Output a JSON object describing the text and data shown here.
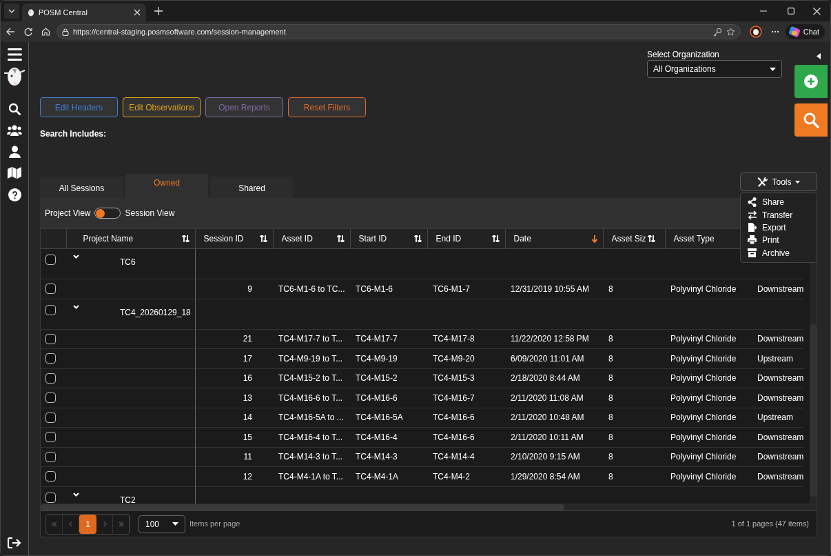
{
  "browser": {
    "tab_title": "POSM Central",
    "url": "https://central-staging.posmsoftware.com/session-management",
    "chat_label": "Chat"
  },
  "organization": {
    "label": "Select Organization",
    "value": "All Organizations"
  },
  "action_buttons": [
    {
      "label": "Edit Headers",
      "color": "#3f7dd6"
    },
    {
      "label": "Edit Observations",
      "color": "#e0a21a"
    },
    {
      "label": "Open Reports",
      "color": "#7d6aa8"
    },
    {
      "label": "Reset Filters",
      "color": "#e0692a"
    }
  ],
  "search_includes": "Search Includes:",
  "tabs": [
    {
      "label": "All Sessions",
      "selected": false
    },
    {
      "label": "Owned",
      "selected": true
    },
    {
      "label": "Shared",
      "selected": false
    }
  ],
  "view_toggle": {
    "left_label": "Project View",
    "right_label": "Session View",
    "on": false
  },
  "tools": {
    "label": "Tools",
    "expanded": true,
    "menu": [
      {
        "label": "Share"
      },
      {
        "label": "Transfer"
      },
      {
        "label": "Export"
      },
      {
        "label": "Print"
      },
      {
        "label": "Archive"
      }
    ]
  },
  "table": {
    "columns": [
      {
        "label": "Project Name",
        "sortable": true,
        "sorted_descending": false
      },
      {
        "label": "Session ID",
        "sortable": true,
        "sorted_descending": false
      },
      {
        "label": "Asset ID",
        "sortable": true,
        "sorted_descending": false
      },
      {
        "label": "Start ID",
        "sortable": true,
        "sorted_descending": false
      },
      {
        "label": "End ID",
        "sortable": true,
        "sorted_descending": false
      },
      {
        "label": "Date",
        "sortable": true,
        "sorted_descending": true
      },
      {
        "label": "Asset Siz",
        "sortable": true,
        "sorted_descending": false
      },
      {
        "label": "Asset Type",
        "sortable": false,
        "sorted_descending": false
      }
    ],
    "groups": [
      {
        "name": "TC6",
        "expanded": true,
        "checked": false,
        "rows": [
          {
            "checked": false,
            "session_id": "9",
            "asset_id": "TC6-M1-6 to TC...",
            "start_id": "TC6-M1-6",
            "end_id": "TC6-M1-7",
            "date": "12/31/2019 10:55 AM",
            "asset_size": "8",
            "asset_type": "Polyvinyl Chloride",
            "column_10": "Downstream"
          }
        ]
      },
      {
        "name": "TC4_20260129_18",
        "expanded": true,
        "checked": false,
        "rows": [
          {
            "checked": false,
            "session_id": "21",
            "asset_id": "TC4-M17-7 to T...",
            "start_id": "TC4-M17-7",
            "end_id": "TC4-M17-8",
            "date": "11/22/2020 12:58 PM",
            "asset_size": "8",
            "asset_type": "Polyvinyl Chloride",
            "column_10": "Downstream"
          },
          {
            "checked": false,
            "session_id": "17",
            "asset_id": "TC4-M9-19 to T...",
            "start_id": "TC4-M9-19",
            "end_id": "TC4-M9-20",
            "date": "6/09/2020 11:01 AM",
            "asset_size": "8",
            "asset_type": "Polyvinyl Chloride",
            "column_10": "Upstream"
          },
          {
            "checked": false,
            "session_id": "16",
            "asset_id": "TC4-M15-2 to T...",
            "start_id": "TC4-M15-2",
            "end_id": "TC4-M15-3",
            "date": "2/18/2020 8:44 AM",
            "asset_size": "8",
            "asset_type": "Polyvinyl Chloride",
            "column_10": "Downstream"
          },
          {
            "checked": false,
            "session_id": "13",
            "asset_id": "TC4-M16-6 to T...",
            "start_id": "TC4-M16-6",
            "end_id": "TC4-M16-7",
            "date": "2/11/2020 11:08 AM",
            "asset_size": "8",
            "asset_type": "Polyvinyl Chloride",
            "column_10": "Downstream"
          },
          {
            "checked": false,
            "session_id": "14",
            "asset_id": "TC4-M16-5A to ...",
            "start_id": "TC4-M16-5A",
            "end_id": "TC4-M16-6",
            "date": "2/11/2020 10:48 AM",
            "asset_size": "8",
            "asset_type": "Polyvinyl Chloride",
            "column_10": "Upstream"
          },
          {
            "checked": false,
            "session_id": "15",
            "asset_id": "TC4-M16-4 to T...",
            "start_id": "TC4-M16-4",
            "end_id": "TC4-M16-6",
            "date": "2/11/2020 10:11 AM",
            "asset_size": "8",
            "asset_type": "Polyvinyl Chloride",
            "column_10": "Downstream"
          },
          {
            "checked": false,
            "session_id": "11",
            "asset_id": "TC4-M14-3 to T...",
            "start_id": "TC4-M14-3",
            "end_id": "TC4-M14-4",
            "date": "2/10/2020 9:15 AM",
            "asset_size": "8",
            "asset_type": "Polyvinyl Chloride",
            "column_10": "Downstream"
          },
          {
            "checked": false,
            "session_id": "12",
            "asset_id": "TC4-M4-1A to T...",
            "start_id": "TC4-M4-1A",
            "end_id": "TC4-M4-2",
            "date": "1/29/2020 8:54 AM",
            "asset_size": "8",
            "asset_type": "Polyvinyl Chloride",
            "column_10": "Downstream"
          }
        ]
      },
      {
        "name": "TC2",
        "expanded": true,
        "checked": false
      }
    ]
  },
  "pagination": {
    "pages": [
      {
        "label": "1",
        "selected": true
      }
    ],
    "page_size": "100",
    "page_size_label": "Items per page",
    "summary": "1 of 1 pages (47 items)"
  }
}
